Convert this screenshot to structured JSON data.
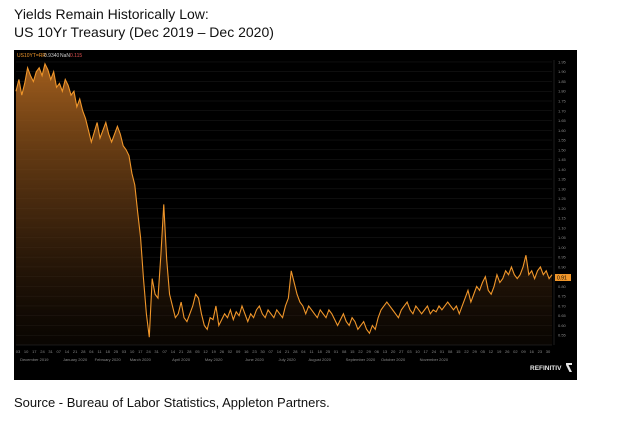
{
  "title": {
    "line1": "Yields Remain Historically Low:",
    "line2": "US 10Yr Treasury (Dec 2019 – Dec 2020)"
  },
  "source": "Source - Bureau of Labor Statistics, Appleton Partners.",
  "chart_header": {
    "ticker": "US10YT=RR",
    "value": "0.9340",
    "label2": "NaN",
    "label3": "0.115"
  },
  "brand": "REFINITIV",
  "last_value_tag": "0.91",
  "colors": {
    "background": "#000000",
    "line": "#f0962a",
    "fill_top": "#9a5a1c",
    "axis_text": "#8a8a8a",
    "tag_bg": "#f0962a"
  },
  "chart_data": {
    "type": "area",
    "ylim": [
      0.5,
      1.96
    ],
    "y_ticks": [
      0.55,
      0.6,
      0.65,
      0.7,
      0.75,
      0.8,
      0.85,
      0.9,
      0.95,
      1.0,
      1.05,
      1.1,
      1.15,
      1.2,
      1.25,
      1.3,
      1.35,
      1.4,
      1.45,
      1.5,
      1.55,
      1.6,
      1.65,
      1.7,
      1.75,
      1.8,
      1.85,
      1.9,
      1.95
    ],
    "x_day_ticks": [
      "03",
      "10",
      "17",
      "24",
      "31",
      "07",
      "14",
      "21",
      "28",
      "04",
      "11",
      "18",
      "25",
      "03",
      "10",
      "17",
      "24",
      "31",
      "07",
      "14",
      "21",
      "28",
      "05",
      "12",
      "19",
      "26",
      "02",
      "09",
      "16",
      "23",
      "30",
      "07",
      "14",
      "21",
      "28",
      "04",
      "11",
      "18",
      "25",
      "01",
      "08",
      "15",
      "22",
      "29",
      "06",
      "13",
      "20",
      "27",
      "03",
      "10",
      "17",
      "24",
      "01",
      "08",
      "15",
      "22",
      "29",
      "05",
      "12",
      "19",
      "26",
      "02",
      "09",
      "16",
      "23",
      "30"
    ],
    "x_month_labels": [
      "December 2019",
      "January 2020",
      "February 2020",
      "March 2020",
      "April 2020",
      "May 2020",
      "June 2020",
      "July 2020",
      "August 2020",
      "September 2020",
      "October 2020",
      "November 2020"
    ],
    "series": [
      {
        "values": [
          1.8,
          1.86,
          1.78,
          1.84,
          1.92,
          1.88,
          1.85,
          1.9,
          1.92,
          1.88,
          1.94,
          1.91,
          1.86,
          1.9,
          1.82,
          1.84,
          1.8,
          1.86,
          1.83,
          1.78,
          1.8,
          1.72,
          1.76,
          1.7,
          1.66,
          1.6,
          1.54,
          1.59,
          1.64,
          1.56,
          1.6,
          1.64,
          1.58,
          1.54,
          1.58,
          1.62,
          1.58,
          1.52,
          1.5,
          1.47,
          1.38,
          1.32,
          1.18,
          1.05,
          0.84,
          0.66,
          0.54,
          0.84,
          0.76,
          0.74,
          0.96,
          1.22,
          0.94,
          0.76,
          0.7,
          0.64,
          0.66,
          0.72,
          0.64,
          0.62,
          0.66,
          0.7,
          0.76,
          0.74,
          0.66,
          0.6,
          0.58,
          0.64,
          0.63,
          0.7,
          0.6,
          0.63,
          0.66,
          0.64,
          0.68,
          0.63,
          0.67,
          0.65,
          0.7,
          0.66,
          0.62,
          0.66,
          0.64,
          0.68,
          0.7,
          0.66,
          0.64,
          0.68,
          0.66,
          0.64,
          0.68,
          0.66,
          0.64,
          0.7,
          0.74,
          0.88,
          0.82,
          0.76,
          0.72,
          0.7,
          0.66,
          0.7,
          0.68,
          0.66,
          0.64,
          0.68,
          0.66,
          0.64,
          0.68,
          0.66,
          0.63,
          0.6,
          0.63,
          0.66,
          0.62,
          0.6,
          0.64,
          0.62,
          0.58,
          0.6,
          0.62,
          0.58,
          0.56,
          0.6,
          0.58,
          0.64,
          0.68,
          0.7,
          0.72,
          0.7,
          0.68,
          0.66,
          0.64,
          0.68,
          0.7,
          0.72,
          0.68,
          0.66,
          0.7,
          0.68,
          0.66,
          0.68,
          0.7,
          0.66,
          0.68,
          0.67,
          0.7,
          0.68,
          0.7,
          0.72,
          0.7,
          0.68,
          0.7,
          0.66,
          0.7,
          0.74,
          0.78,
          0.72,
          0.76,
          0.8,
          0.78,
          0.82,
          0.85,
          0.78,
          0.76,
          0.8,
          0.86,
          0.82,
          0.84,
          0.88,
          0.86,
          0.9,
          0.86,
          0.84,
          0.86,
          0.9,
          0.96,
          0.86,
          0.88,
          0.84,
          0.88,
          0.9,
          0.86,
          0.88,
          0.84,
          0.86
        ]
      }
    ]
  }
}
